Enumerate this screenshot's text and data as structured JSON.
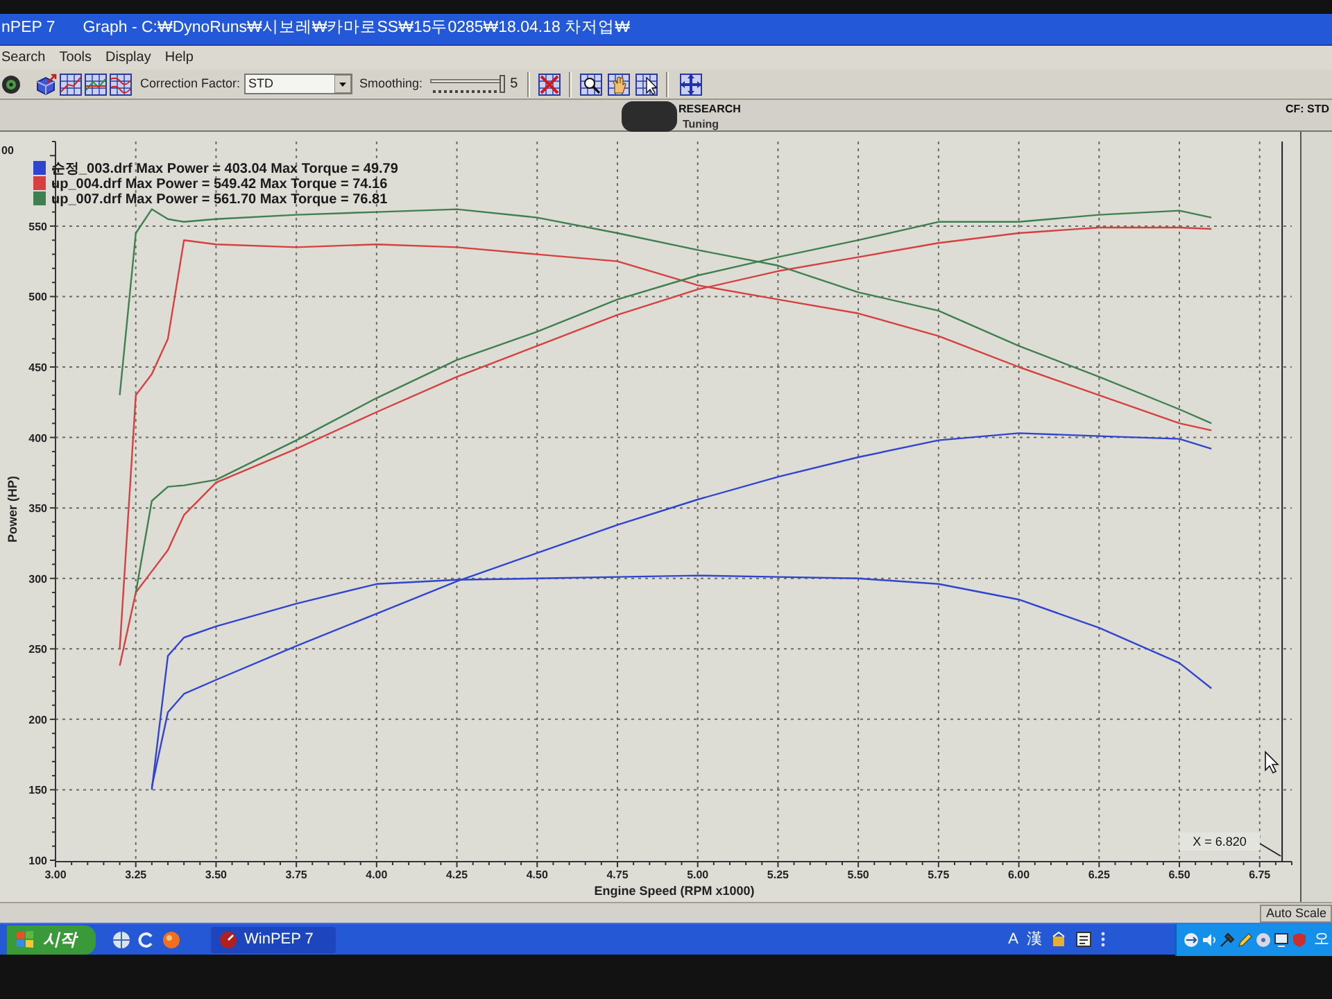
{
  "window": {
    "app_name": "nPEP 7",
    "title": "Graph - C:₩DynoRuns₩시보레₩카마로SS₩15두0285₩18.04.18 차저업₩"
  },
  "menu": [
    "Search",
    "Tools",
    "Display",
    "Help"
  ],
  "toolbar": {
    "correction_factor": {
      "label": "Correction Factor:",
      "value": "STD"
    },
    "smoothing": {
      "label": "Smoothing:",
      "value": "5",
      "level": 1
    }
  },
  "graph": {
    "header": {
      "title": "RESEARCH",
      "subtitle": "Tuning"
    },
    "cf_label": "CF: STD",
    "legend": [
      {
        "text": "순정_003.drf Max Power = 403.04 Max Torque = 49.79",
        "color": "#2f45d0"
      },
      {
        "text": "up_004.drf Max Power = 549.42 Max Torque = 74.16",
        "color": "#d6403f"
      },
      {
        "text": "up_007.drf Max Power = 561.70 Max Torque = 76.81",
        "color": "#3f8050"
      }
    ],
    "cut_off_tick_label": "00",
    "cursor_readout": "X = 6.820",
    "chart_data": {
      "type": "line",
      "xlabel": "Engine Speed (RPM x1000)",
      "ylabel": "Power (HP)",
      "xlim": [
        3.0,
        6.85
      ],
      "ylim": [
        100,
        610
      ],
      "grid": true,
      "xticks": [
        {
          "value": 3,
          "label": "3.00"
        },
        3.25,
        {
          "value": 3.5,
          "label": "3.50"
        },
        3.75,
        {
          "value": 4,
          "label": "4.00"
        },
        4.25,
        {
          "value": 4.5,
          "label": "4.50"
        },
        4.75,
        {
          "value": 5,
          "label": "5.00"
        },
        5.25,
        {
          "value": 5.5,
          "label": "5.50"
        },
        5.75,
        {
          "value": 6,
          "label": "6.00"
        },
        6.25,
        {
          "value": 6.5,
          "label": "6.50"
        },
        6.75
      ],
      "yticks": [
        100,
        150,
        200,
        250,
        300,
        350,
        400,
        450,
        500,
        550
      ],
      "x": [
        3.2,
        3.25,
        3.3,
        3.35,
        3.4,
        3.5,
        3.75,
        4.0,
        4.25,
        4.5,
        4.75,
        5.0,
        5.25,
        5.5,
        5.75,
        6.0,
        6.25,
        6.5,
        6.6
      ],
      "series": [
        {
          "color": "#2f45d0",
          "values": [
            null,
            null,
            152,
            205,
            218,
            228,
            252,
            275,
            298,
            318,
            338,
            356,
            372,
            386,
            398,
            403,
            401,
            399,
            392
          ]
        },
        {
          "color": "#2f45d0",
          "values": [
            null,
            null,
            150,
            245,
            258,
            266,
            282,
            296,
            299,
            300,
            301,
            302,
            301,
            300,
            296,
            285,
            265,
            240,
            222
          ]
        },
        {
          "color": "#d6403f",
          "values": [
            238,
            290,
            305,
            320,
            345,
            368,
            392,
            418,
            443,
            465,
            487,
            505,
            518,
            528,
            538,
            545,
            549,
            549,
            548
          ]
        },
        {
          "color": "#d6403f",
          "values": [
            250,
            430,
            445,
            470,
            540,
            537,
            535,
            537,
            535,
            530,
            525,
            508,
            498,
            488,
            472,
            450,
            430,
            410,
            405
          ]
        },
        {
          "color": "#3f8050",
          "values": [
            null,
            290,
            355,
            365,
            366,
            370,
            398,
            428,
            455,
            475,
            498,
            515,
            528,
            540,
            553,
            553,
            558,
            561,
            556
          ]
        },
        {
          "color": "#3f8050",
          "values": [
            430,
            545,
            562,
            555,
            553,
            555,
            558,
            560,
            562,
            556,
            545,
            533,
            522,
            503,
            490,
            465,
            443,
            420,
            410
          ]
        }
      ],
      "ref_lines": [
        {
          "axis": "x",
          "value": 6.82
        }
      ]
    }
  },
  "status_bar": {
    "mode": "Auto Scale"
  },
  "taskbar": {
    "start": "시작",
    "tasks": [
      {
        "label": "WinPEP 7"
      }
    ],
    "language_bar": [
      "A",
      "漢"
    ],
    "clock": "오"
  }
}
